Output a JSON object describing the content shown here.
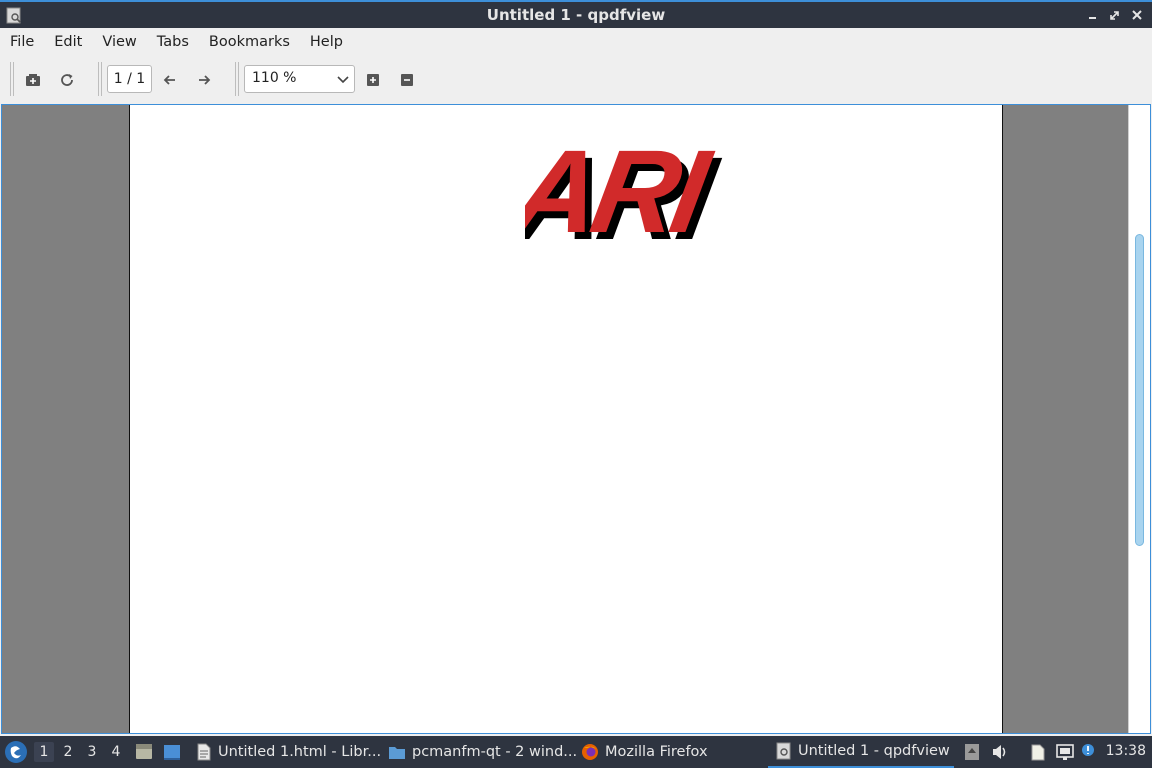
{
  "window": {
    "title": "Untitled 1 - qpdfview",
    "app_icon": "document-viewer-icon",
    "controls": [
      "minimize-icon",
      "maximize-icon",
      "close-icon"
    ]
  },
  "menubar": {
    "items": [
      "File",
      "Edit",
      "View",
      "Tabs",
      "Bookmarks",
      "Help"
    ]
  },
  "toolbar": {
    "open_icon": "open-file-icon",
    "refresh_icon": "refresh-icon",
    "page_indicator": "1 / 1",
    "prev_icon": "arrow-left-icon",
    "next_icon": "arrow-right-icon",
    "zoom_value": "110 %",
    "zoom_in_icon": "zoom-in-icon",
    "zoom_out_icon": "zoom-out-icon"
  },
  "document": {
    "logo_text": "ARI",
    "logo_color": "#d12a2a",
    "shadow_color": "#000000"
  },
  "taskbar": {
    "desktops": [
      "1",
      "2",
      "3",
      "4"
    ],
    "active_desktop": "1",
    "tasks": [
      {
        "label": "Untitled 1.html - Libr...",
        "icon": "document-icon"
      },
      {
        "label": "pcmanfm-qt - 2 wind...",
        "icon": "folder-icon"
      },
      {
        "label": "Mozilla Firefox",
        "icon": "firefox-icon"
      },
      {
        "label": "Untitled 1 - qpdfview",
        "icon": "document-viewer-icon"
      }
    ],
    "clock": "13:38"
  },
  "colors": {
    "titlebar": "#2e3440",
    "accent": "#3d8fd9",
    "viewport_bg": "#808080"
  }
}
